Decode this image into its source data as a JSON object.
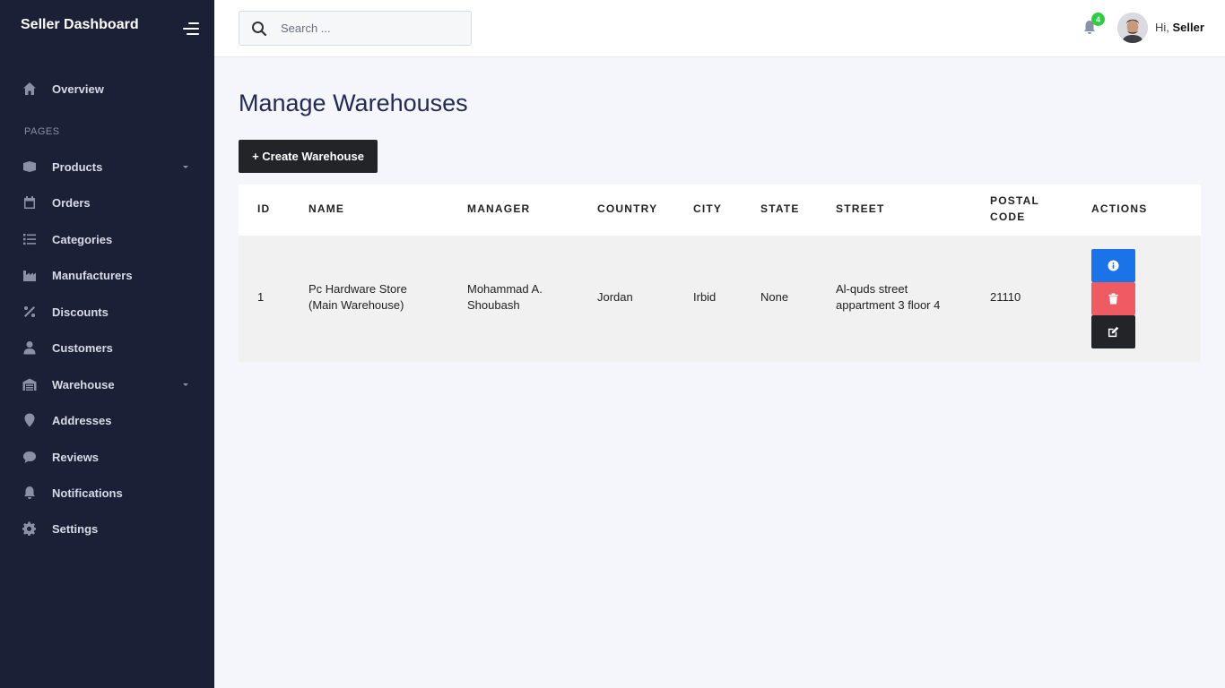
{
  "sidebar": {
    "brand": "Seller Dashboard",
    "overview": "Overview",
    "section_label": "PAGES",
    "items": [
      {
        "label": "Products",
        "icon": "box-icon",
        "has_caret": true
      },
      {
        "label": "Orders",
        "icon": "calendar-icon",
        "has_caret": false
      },
      {
        "label": "Categories",
        "icon": "list-icon",
        "has_caret": false
      },
      {
        "label": "Manufacturers",
        "icon": "factory-icon",
        "has_caret": false
      },
      {
        "label": "Discounts",
        "icon": "percent-icon",
        "has_caret": false
      },
      {
        "label": "Customers",
        "icon": "user-icon",
        "has_caret": false
      },
      {
        "label": "Warehouse",
        "icon": "warehouse-icon",
        "has_caret": true
      },
      {
        "label": "Addresses",
        "icon": "map-pin-icon",
        "has_caret": false
      },
      {
        "label": "Reviews",
        "icon": "comment-icon",
        "has_caret": false
      },
      {
        "label": "Notifications",
        "icon": "bell-icon",
        "has_caret": false
      },
      {
        "label": "Settings",
        "icon": "gear-icon",
        "has_caret": false
      }
    ]
  },
  "topbar": {
    "search_placeholder": "Search ...",
    "notification_count": "4",
    "greeting_prefix": "Hi, ",
    "user_name": "Seller"
  },
  "main": {
    "title": "Manage Warehouses",
    "create_button": "+ Create Warehouse"
  },
  "table": {
    "headers": {
      "id": "ID",
      "name": "NAME",
      "manager": "MANAGER",
      "country": "COUNTRY",
      "city": "CITY",
      "state": "STATE",
      "street": "STREET",
      "postal_line1": "POSTAL",
      "postal_line2": "CODE",
      "actions": "ACTIONS"
    },
    "rows": [
      {
        "id": "1",
        "name_line1": "Pc Hardware Store",
        "name_line2": "(Main Warehouse)",
        "manager_line1": "Mohammad A.",
        "manager_line2": "Shoubash",
        "country": "Jordan",
        "city": "Irbid",
        "state": "None",
        "street_line1": "Al-quds street",
        "street_line2": "appartment 3 floor 4",
        "postal_code": "21110"
      }
    ]
  },
  "colors": {
    "sidebar_bg": "#1c2037",
    "info_button": "#1a73e8",
    "delete_button": "#ef5a63",
    "edit_button": "#222428",
    "badge": "#2ecc40",
    "title": "#232a53"
  }
}
